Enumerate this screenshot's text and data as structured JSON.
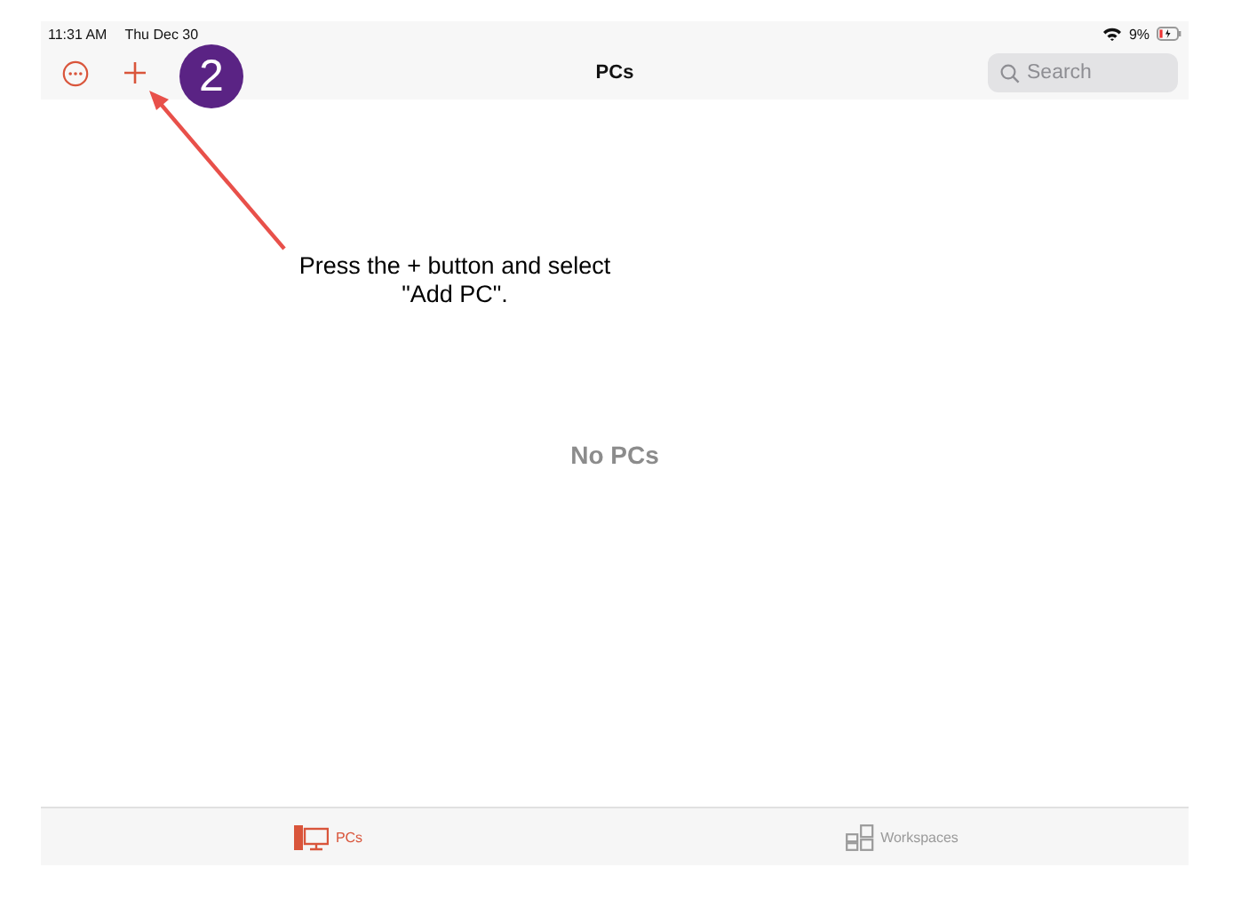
{
  "status_bar": {
    "time": "11:31 AM",
    "date": "Thu Dec 30",
    "battery": "9%"
  },
  "nav_bar": {
    "title": "PCs",
    "search": {
      "placeholder": "Search"
    }
  },
  "content": {
    "empty_message": "No PCs"
  },
  "tab_bar": {
    "tabs": [
      {
        "label": "PCs",
        "kind": "pcs",
        "selected": true
      },
      {
        "label": "Workspaces",
        "kind": "workspaces",
        "selected": false
      }
    ]
  },
  "annotation": {
    "step": "2",
    "callout_lines": [
      "Press the + button and select",
      "\"Add PC\"."
    ]
  }
}
